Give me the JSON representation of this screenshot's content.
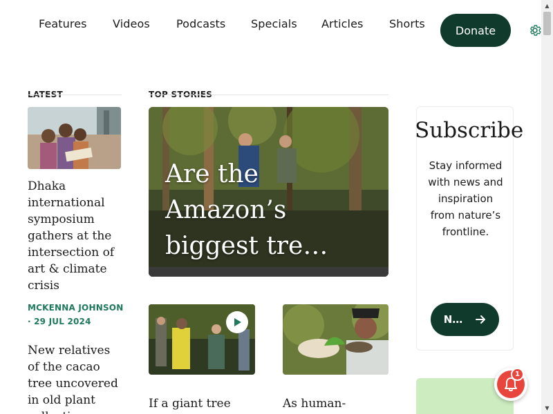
{
  "nav": {
    "items": [
      "Features",
      "Videos",
      "Podcasts",
      "Specials",
      "Articles",
      "Shorts"
    ],
    "donate_label": "Donate",
    "icons": {
      "settings": "gear-icon"
    }
  },
  "latest": {
    "label": "LATEST",
    "article1": {
      "title": "Dhaka international symposium gathers at the intersection of art & climate crisis",
      "byline": "MCKENNA JOHNSON · 29 JUL 2024"
    },
    "article2": {
      "title": "New relatives of the cacao tree uncovered in old plant collections"
    }
  },
  "top_stories": {
    "label": "TOP STORIES",
    "hero_title": "Are the Amazon’s biggest tre…",
    "cards": [
      {
        "title": "If a giant tree",
        "has_video": true
      },
      {
        "title": "As human-"
      }
    ]
  },
  "subscribe": {
    "title": "Subscribe",
    "text": "Stay informed with news and inspiration from nature’s frontline.",
    "button_label": "N…",
    "icon": "arrow-right-icon"
  },
  "notifications": {
    "count": "1",
    "icon": "bell-icon"
  },
  "colors": {
    "brand_dark_green": "#0f3a2c",
    "byline_green": "#1f7a5a",
    "light_green": "#cdecc0",
    "notification_red": "#e8453c"
  }
}
